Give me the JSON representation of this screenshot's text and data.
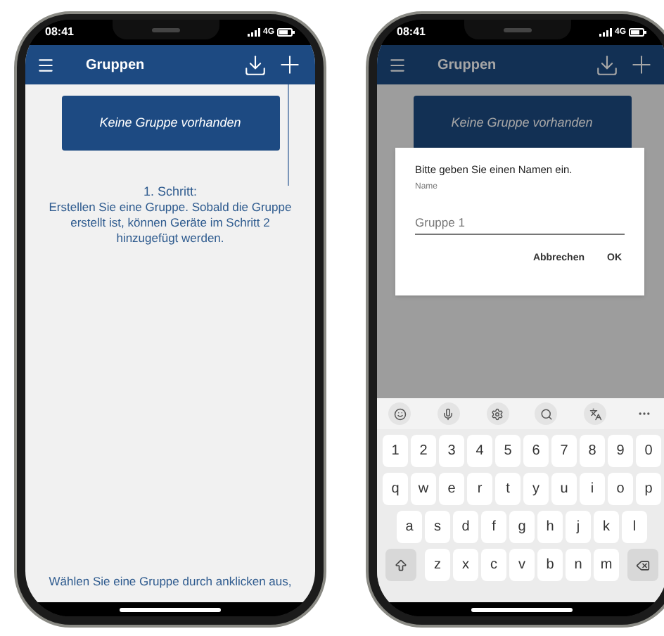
{
  "phones": [
    {
      "status_bar": {
        "time": "08:41",
        "network": "4G"
      },
      "app_bar": {
        "title": "Gruppen"
      },
      "group_button": "Keine Gruppe vorhanden",
      "step_title": "1. Schritt:",
      "step_text": "Erstellen Sie eine Gruppe. Sobald die Gruppe erstellt ist, können Geräte im Schritt 2 hinzugefügt werden.",
      "footer_text": "Wählen Sie eine Gruppe durch anklicken aus,"
    },
    {
      "status_bar": {
        "time": "08:41",
        "network": "4G"
      },
      "app_bar": {
        "title": "Gruppen"
      },
      "group_button": "Keine Gruppe vorhanden",
      "dialog": {
        "message": "Bitte geben Sie einen Namen ein.",
        "field_label": "Name",
        "placeholder": "Gruppe 1",
        "buttons": [
          "Abbrechen",
          "OK"
        ]
      },
      "keyboard": {
        "rows": [
          [
            "1",
            "2",
            "3",
            "4",
            "5",
            "6",
            "7",
            "8",
            "9",
            "0"
          ],
          [
            "q",
            "w",
            "e",
            "r",
            "t",
            "y",
            "u",
            "i",
            "o",
            "p"
          ],
          [
            "a",
            "s",
            "d",
            "f",
            "g",
            "h",
            "j",
            "k",
            "l"
          ],
          [
            "z",
            "x",
            "c",
            "v",
            "b",
            "n",
            "m"
          ]
        ]
      }
    }
  ]
}
